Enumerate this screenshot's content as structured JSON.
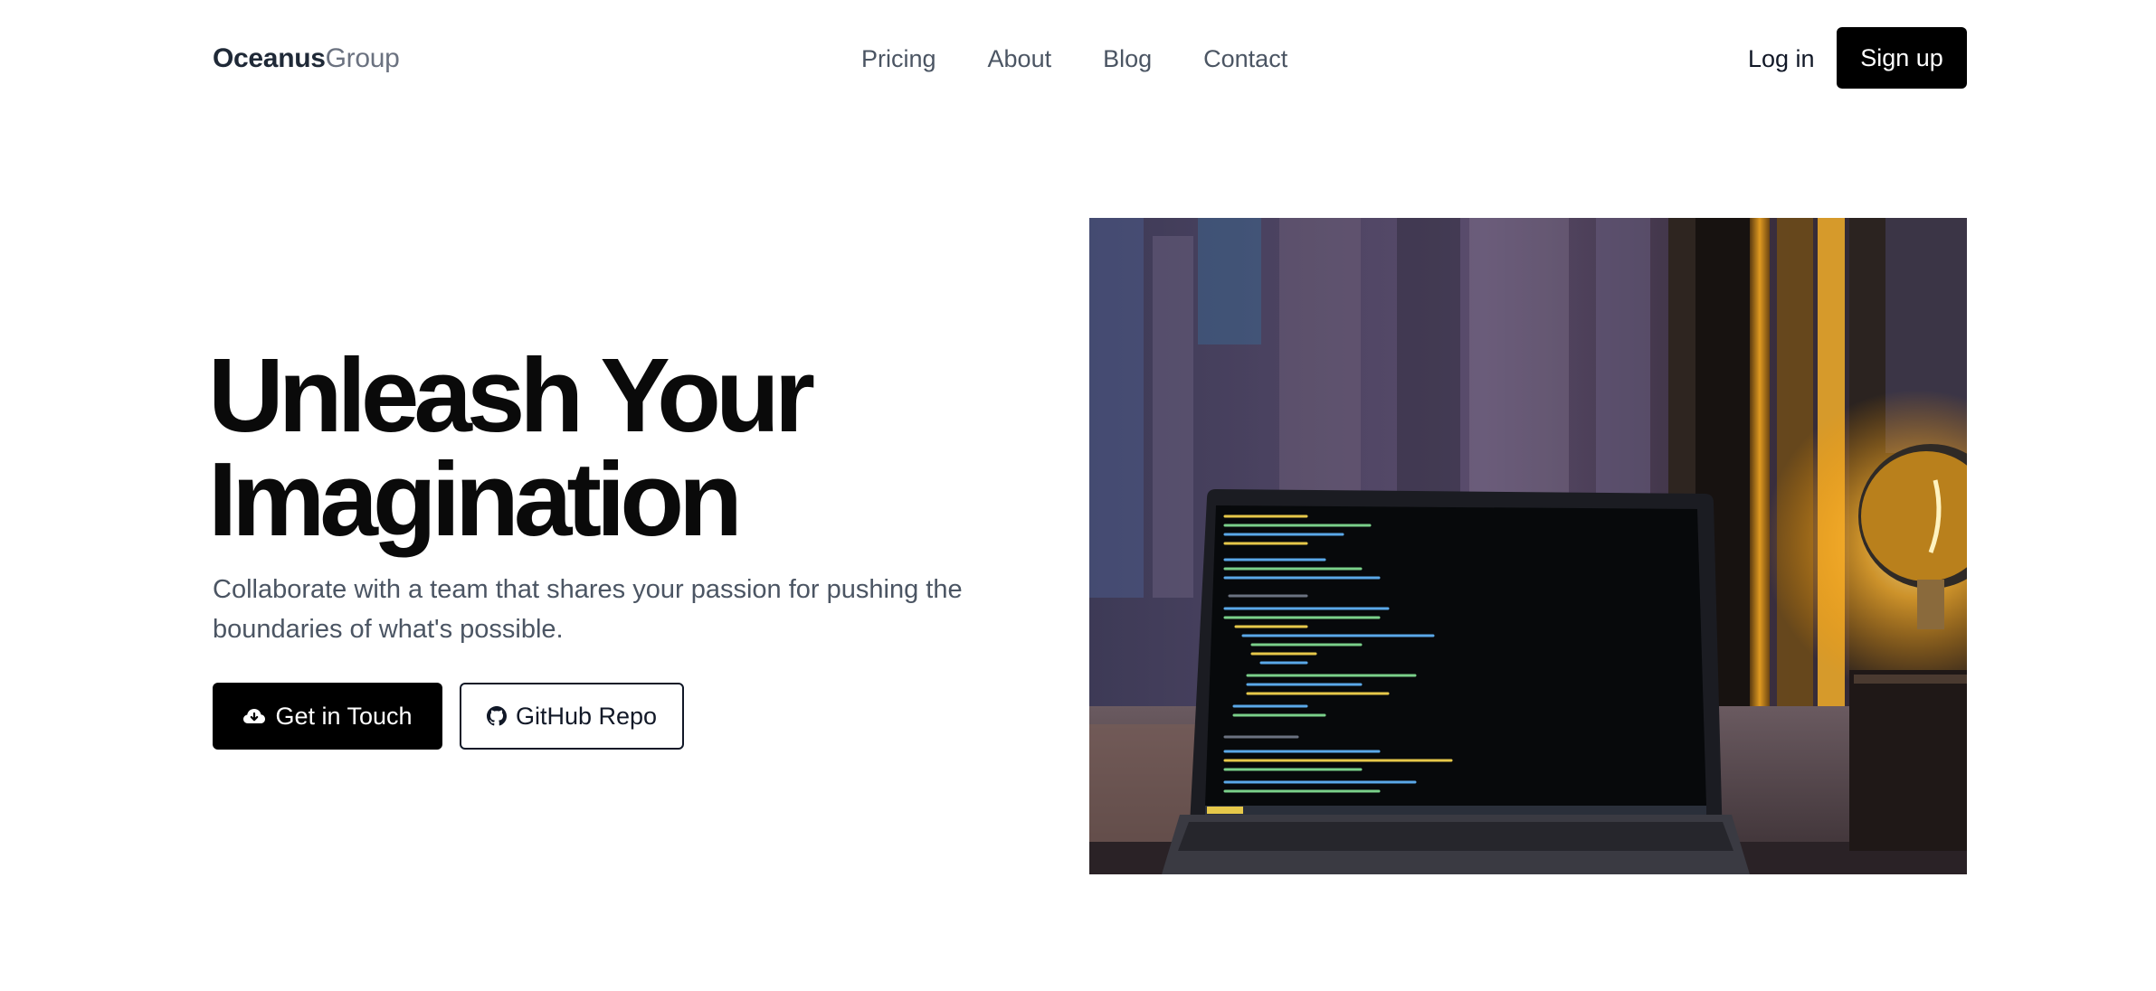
{
  "header": {
    "logo_bold": "Oceanus",
    "logo_light": "Group",
    "nav": [
      "Pricing",
      "About",
      "Blog",
      "Contact"
    ],
    "login_label": "Log in",
    "signup_label": "Sign up"
  },
  "hero": {
    "title_line1": "Unleash Your",
    "title_line2": "Imagination",
    "subtitle": "Collaborate with a team that shares your passion for pushing the boundaries of what's possible.",
    "primary_button": {
      "label": "Get in Touch",
      "icon": "cloud-download-icon"
    },
    "secondary_button": {
      "label": "GitHub Repo",
      "icon": "github-icon"
    },
    "image": {
      "description_icon": "laptop-code-photo"
    }
  },
  "colors": {
    "primary": "#000000",
    "text": "#111827",
    "muted": "#4b5563",
    "background": "#ffffff"
  }
}
